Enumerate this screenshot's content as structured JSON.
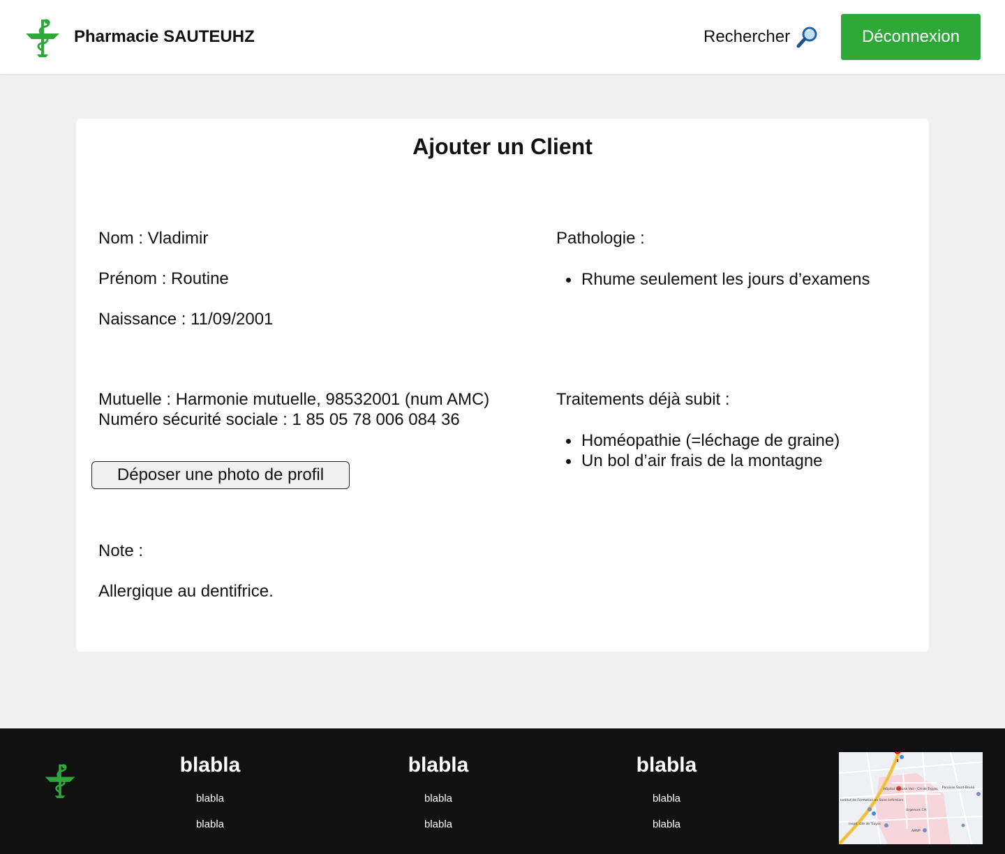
{
  "header": {
    "brand": "Pharmacie SAUTEUHZ",
    "search_label": "Rechercher",
    "logout_label": "Déconnexion",
    "accent_color": "#2fa83a"
  },
  "card": {
    "title": "Ajouter un Client",
    "nom": "Nom : Vladimir",
    "prenom": "Prénom : Routine",
    "naissance": "Naissance : 11/09/2001",
    "mutuelle": "Mutuelle : Harmonie mutuelle, 98532001 (num AMC)",
    "secu": "Numéro sécurité sociale :  1 85 05 78 006 084 36",
    "upload_label": "Déposer une photo de profil",
    "note_label": "Note :",
    "note_value": "Allergique au dentifrice.",
    "pathologie_label": "Pathologie :",
    "pathologies": [
      "Rhume seulement les jours d’examens"
    ],
    "traitements_label": "Traitements déjà subit :",
    "traitements": [
      "Homéopathie (=léchage de graine)",
      "Un bol d’air frais de la montagne"
    ]
  },
  "footer": {
    "columns": [
      {
        "title": "blabla",
        "links": [
          "blabla",
          "blabla"
        ]
      },
      {
        "title": "blabla",
        "links": [
          "blabla",
          "blabla"
        ]
      },
      {
        "title": "blabla",
        "links": [
          "blabla",
          "blabla"
        ]
      }
    ],
    "map_labels": [
      "Hôpital Simone Veil - CH de Troyes",
      "Institut de Formation en Soins Infirmiers",
      "Paroisse Saint-Bruno",
      "Urgences CH",
      "Inspé, site de Troyes",
      "AMVP"
    ]
  },
  "icons": {
    "logo": "pharmacy-caduceus-icon",
    "search": "magnifier-icon"
  }
}
